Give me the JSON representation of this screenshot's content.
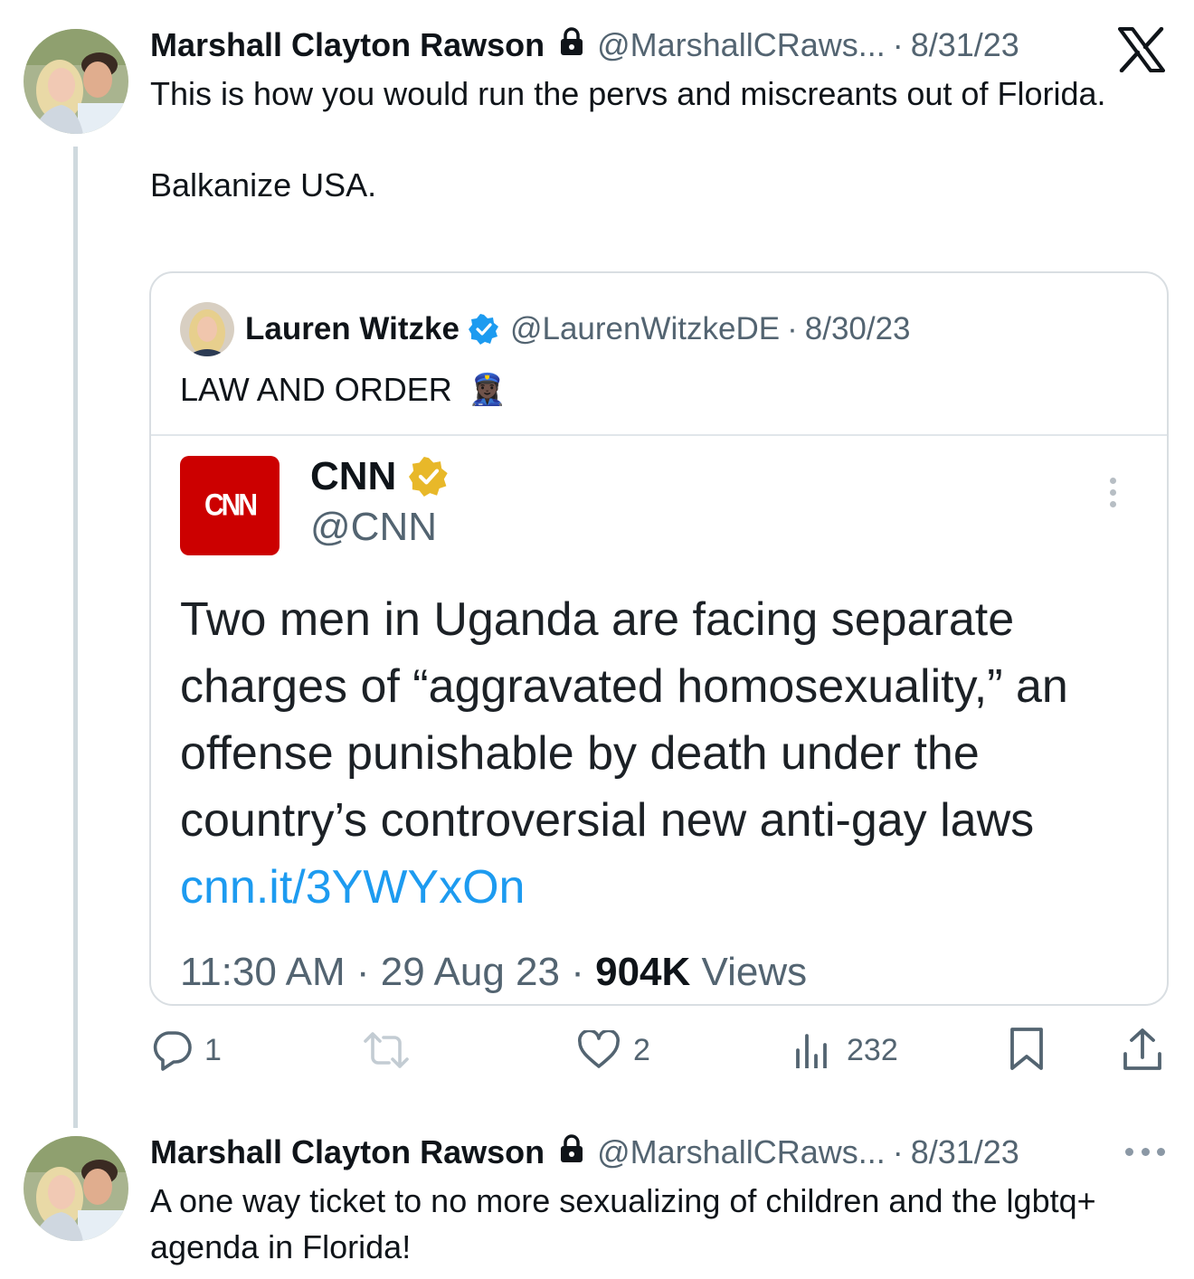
{
  "tweet1": {
    "author_name": "Marshall Clayton Rawson",
    "handle": "@MarshallCRaws...",
    "sep": "·",
    "date": "8/31/23",
    "text_line1": "This is how you would run the pervs and miscreants out of Florida.",
    "text_line2": "Balkanize USA."
  },
  "quote": {
    "author_name": "Lauren Witzke",
    "handle": "@LaurenWitzkeDE",
    "sep": "·",
    "date": "8/30/23",
    "text": "LAW AND ORDER",
    "emoji": "👮🏿‍♀️"
  },
  "embedded": {
    "logo_text": "CNN",
    "name": "CNN",
    "handle": "@CNN",
    "body": "Two men in Uganda are facing separate charges of “aggravated homosexuality,” an offense punishable by death under the country’s controversial new anti-gay laws",
    "link": "cnn.it/3YWYxOn",
    "time": "11:30 AM",
    "sep1": "·",
    "date": "29 Aug 23",
    "sep2": "·",
    "views_count": "904K",
    "views_label": "Views"
  },
  "actions": {
    "reply_count": "1",
    "like_count": "2",
    "views_count": "232"
  },
  "tweet2": {
    "author_name": "Marshall Clayton Rawson",
    "handle": "@MarshallCRaws...",
    "sep": "·",
    "date": "8/31/23",
    "text": "A one way ticket to no more sexualizing of children and the lgbtq+ agenda in Florida!"
  },
  "colors": {
    "link": "#1d9bf0",
    "verified_blue": "#1d9bf0",
    "verified_gold": "#e8b829",
    "cnn_red": "#cc0000",
    "muted": "#536471"
  },
  "icons": [
    "x-logo-icon",
    "lock-icon",
    "verified-badge-icon",
    "reply-icon",
    "retweet-icon",
    "like-icon",
    "views-icon",
    "bookmark-icon",
    "share-icon",
    "more-icon"
  ]
}
